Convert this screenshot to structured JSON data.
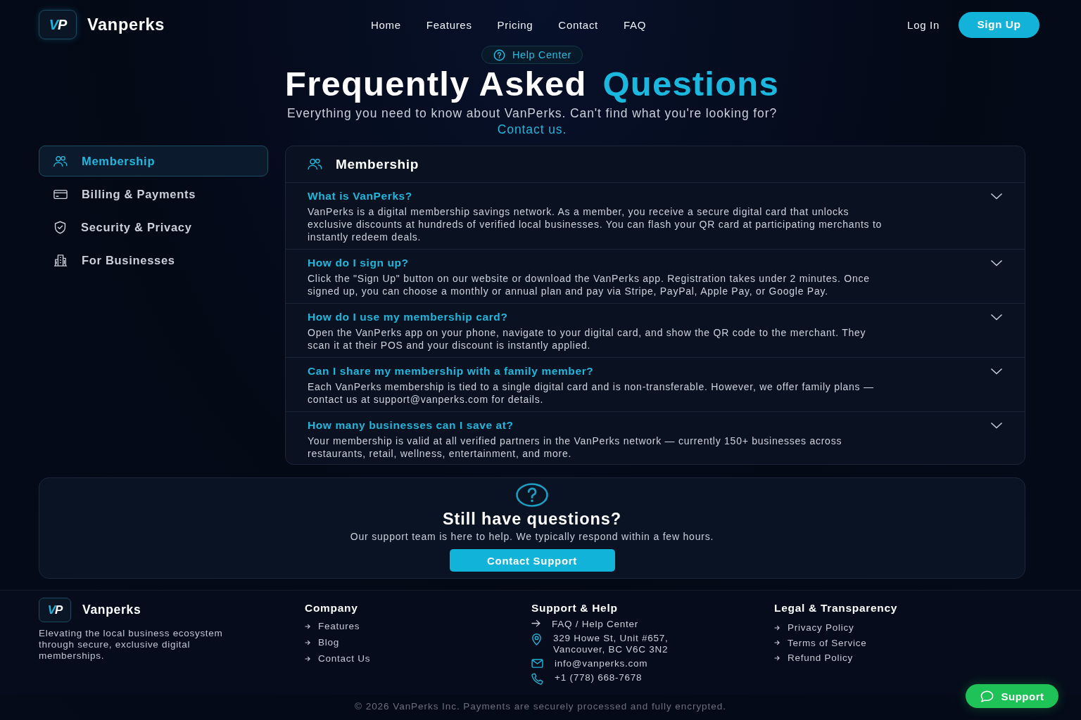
{
  "header": {
    "logo_mark": {
      "accent": "V",
      "rest": "P"
    },
    "brand": "Vanperks",
    "nav": [
      "Home",
      "Features",
      "Pricing",
      "Contact",
      "FAQ"
    ],
    "login": "Log In",
    "signup": "Sign Up"
  },
  "hero": {
    "badge": "Help Center",
    "title": "Frequently Asked",
    "title_accent": "Questions",
    "subtitle": "Everything you need to know about VanPerks. Can't find what you're looking for?",
    "contact_link": "Contact us."
  },
  "categories": [
    {
      "label": "Membership",
      "selected": true
    },
    {
      "label": "Billing & Payments",
      "selected": false
    },
    {
      "label": "Security & Privacy",
      "selected": false
    },
    {
      "label": "For Businesses",
      "selected": false
    }
  ],
  "faq_panel": {
    "title": "Membership",
    "items": [
      {
        "question": "What is VanPerks?",
        "answer": "VanPerks is a digital membership savings network. As a member, you receive a secure digital card that unlocks exclusive discounts at hundreds of verified local businesses. You can flash your QR card at participating merchants to instantly redeem deals.",
        "expanded": true
      },
      {
        "question": "How do I sign up?",
        "answer": "Click the \"Sign Up\" button on our website or download the VanPerks app. Registration takes under 2 minutes. Once signed up, you can choose a monthly or annual plan and pay via Stripe, PayPal, Apple Pay, or Google Pay.",
        "expanded": true
      },
      {
        "question": "How do I use my membership card?",
        "answer": "Open the VanPerks app on your phone, navigate to your digital card, and show the QR code to the merchant. They scan it at their POS and your discount is instantly applied.",
        "expanded": true
      },
      {
        "question": "Can I share my membership with a family member?",
        "answer": "Each VanPerks membership is tied to a single digital card and is non-transferable. However, we offer family plans — contact us at support@vanperks.com for details.",
        "expanded": true
      },
      {
        "question": "How many businesses can I save at?",
        "answer": "Your membership is valid at all verified partners in the VanPerks network — currently 150+ businesses across restaurants, retail, wellness, entertainment, and more.",
        "expanded": true
      }
    ]
  },
  "support_cta": {
    "title": "Still have questions?",
    "text": "Our support team is here to help. We typically respond within a few hours.",
    "button": "Contact Support"
  },
  "footer": {
    "logo_mark": {
      "accent": "V",
      "rest": "P"
    },
    "brand": "Vanperks",
    "tagline": "Elevating the local business ecosystem through secure, exclusive digital memberships.",
    "company": {
      "heading": "Company",
      "links": [
        "Features",
        "Blog",
        "Contact Us"
      ]
    },
    "support": {
      "heading": "Support & Help",
      "items": [
        {
          "kind": "link",
          "lines": [
            "FAQ / Help Center"
          ]
        },
        {
          "kind": "address",
          "lines": [
            "329 Howe St, Unit #657,",
            "Vancouver, BC V6C 3N2"
          ]
        },
        {
          "kind": "email",
          "lines": [
            "info@vanperks.com"
          ]
        },
        {
          "kind": "phone",
          "lines": [
            "+1 (778) 668-7678"
          ]
        }
      ]
    },
    "legal": {
      "heading": "Legal & Transparency",
      "links": [
        "Privacy Policy",
        "Terms of Service",
        "Refund Policy"
      ]
    },
    "copyright": "© 2026 VanPerks Inc. Payments are securely processed and fully encrypted."
  },
  "chat_button": "Support"
}
